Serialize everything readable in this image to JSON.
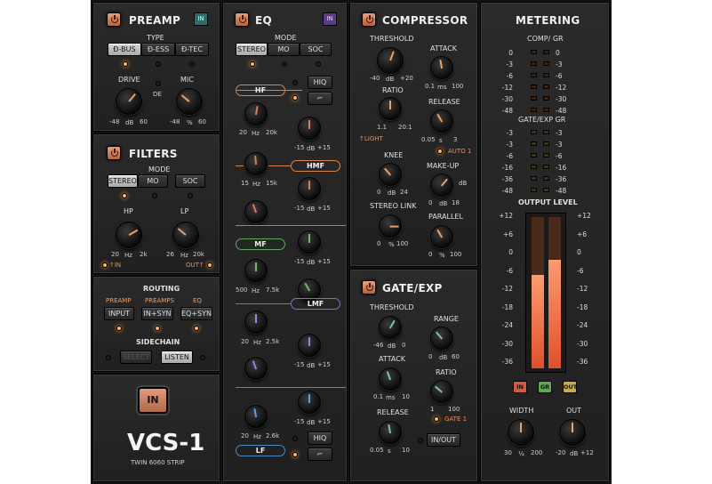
{
  "preamp": {
    "title": "PREAMP",
    "badge": "IN",
    "type_label": "TYPE",
    "types": [
      "Ð-BUS",
      "Ð-ESS",
      "Ð-TEC"
    ],
    "drive": "DRIVE",
    "de": "DE",
    "mic": "MIC",
    "drive_min": "-48",
    "drive_unit": "dB",
    "drive_max": "60",
    "mic_min": "-48",
    "mic_unit": "%",
    "mic_max": "60"
  },
  "filters": {
    "title": "FILTERS",
    "mode_label": "MODE",
    "modes": [
      "STEREO",
      "MO",
      "SOC"
    ],
    "hp": "HP",
    "lp": "LP",
    "hp_min": "20",
    "hp_unit": "Hz",
    "hp_max": "2k",
    "lp_min": "26",
    "lp_unit": "Hz",
    "lp_max": "20k",
    "in": "↑IN",
    "out": "OUT↑"
  },
  "routing": {
    "title": "ROUTING",
    "preamp": "PREAMP",
    "preamps": "PREAMPS",
    "eq": "EQ",
    "input": "INPUT",
    "in_syn": "IN+SYN",
    "eq_syn": "EQ+SYN",
    "sidechain": "SIDECHAIN",
    "select": "SELECT",
    "listen": "LISTEN"
  },
  "main": {
    "in": "IN",
    "logo": "VCS-1",
    "sub": "TWIN 6060 STRIP"
  },
  "eq": {
    "title": "EQ",
    "badge": "IN",
    "mode_label": "MODE",
    "modes": [
      "STEREO",
      "MO",
      "SOC"
    ],
    "hiq": "HIQ",
    "hiq2": "HIQ",
    "hf": "HF",
    "hmf": "HMF",
    "mf": "MF",
    "lmf": "LMF",
    "lf": "LF",
    "k1": [
      "20",
      "Hz",
      "20k"
    ],
    "k2": [
      "-15",
      "dB",
      "+15"
    ],
    "k3": [
      "15",
      "Hz",
      "15k"
    ],
    "k4": [
      "-15",
      "dB",
      "+15"
    ],
    "k5": [
      "-15",
      "dB",
      "+15"
    ],
    "k6": [
      "500",
      "Hz",
      "7.5k"
    ],
    "k7": [
      "-15",
      "dB",
      "+15"
    ],
    "k8": [
      "20",
      "Hz",
      "2.5k"
    ],
    "k9": [
      "-15",
      "dB",
      "+15"
    ],
    "k10": [
      "-15",
      "dB",
      "+15"
    ],
    "k11": [
      "20",
      "Hz",
      "2.6k"
    ],
    "k12": [
      "-15",
      "dB",
      "+15"
    ]
  },
  "comp": {
    "title": "COMPRESSOR",
    "threshold": "THRESHOLD",
    "th": [
      "-40",
      "dB",
      "+20"
    ],
    "attack": "ATTACK",
    "at": [
      "0.1",
      "ms",
      "100"
    ],
    "ratio": "RATIO",
    "ra": [
      "1.1",
      "",
      "20:1"
    ],
    "light": "↑LIGHT",
    "release": "RELEASE",
    "re": [
      "0.05",
      "s",
      "3"
    ],
    "auto": "AUTO 1",
    "knee": "KNEE",
    "kn": [
      "0",
      "dB",
      "24"
    ],
    "makeup": "MAKE-UP",
    "mk": [
      "0",
      "dB",
      "18"
    ],
    "db": "dB",
    "stereo_link": "STEREO LINK",
    "sl": [
      "0",
      "%",
      "100"
    ],
    "parallel": "PARALLEL",
    "pa": [
      "0",
      "%",
      "100"
    ]
  },
  "gate": {
    "title": "GATE/EXP",
    "threshold": "THRESHOLD",
    "th": [
      "-46",
      "dB",
      "0"
    ],
    "range": "RANGE",
    "rg": [
      "0",
      "dB",
      "60"
    ],
    "attack": "ATTACK",
    "at": [
      "0.1",
      "ms",
      "10"
    ],
    "ratio": "RATIO",
    "ra": [
      "1",
      "",
      "100"
    ],
    "gate1": "GATE 1",
    "release": "RELEASE",
    "re": [
      "0.05",
      "s",
      "10"
    ],
    "inout": "IN/OUT"
  },
  "meter": {
    "title": "METERING",
    "comp_gr": "COMP/ GR",
    "gate_gr": "GATE/EXP GR",
    "gr_left": [
      "0",
      "-3",
      "-6",
      "-12",
      "-30",
      "-48"
    ],
    "gr_right": [
      "0",
      "-3",
      "-6",
      "-12",
      "-30",
      "-48"
    ],
    "g_left": [
      "-3",
      "-3",
      "-6",
      "-16",
      "-36",
      "-48"
    ],
    "g_right": [
      "-3",
      "-3",
      "-6",
      "-16",
      "-36",
      "-48"
    ],
    "output_level": "OUTPUT LEVEL",
    "scale": [
      "+12",
      "+6",
      "0",
      "-6",
      "-12",
      "-18",
      "-24",
      "-30",
      "-36"
    ],
    "left_level": 0.62,
    "right_level": 0.72,
    "btn_in": "IN",
    "btn_gr": "GR",
    "btn_out": "OUT",
    "width": "WIDTH",
    "out": "OUT",
    "w": [
      "30",
      "¼",
      "200"
    ],
    "o": [
      "-20",
      "dB",
      "+12"
    ]
  }
}
